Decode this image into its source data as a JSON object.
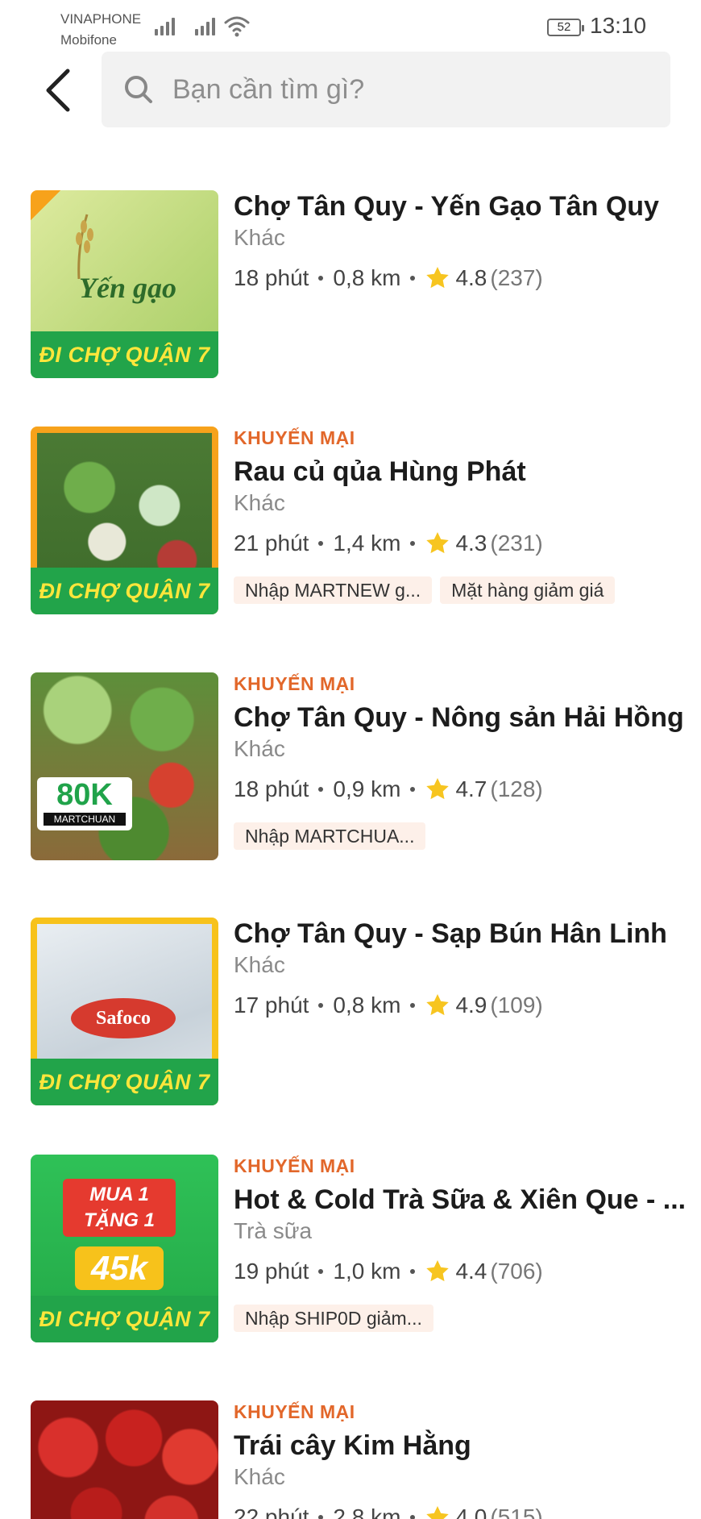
{
  "status_bar": {
    "carrier_1": "VINAPHONE",
    "carrier_2": "Mobifone",
    "battery": "52",
    "time": "13:10"
  },
  "search": {
    "placeholder": "Bạn cần tìm gì?"
  },
  "colors": {
    "promo": "#e2672a",
    "tag_bg": "#fdf0e9",
    "star": "#f7c520",
    "banner_green": "#22a44a"
  },
  "stores": [
    {
      "promo": "",
      "name": "Chợ Tân Quy - Yến Gạo Tân Quy",
      "category": "Khác",
      "time": "18 phút",
      "distance": "0,8 km",
      "rating": "4.8",
      "reviews": "(237)",
      "tags": [],
      "thumb_banner": "ĐI CHỢ QUẬN 7",
      "thumb_text": "Yến gạo"
    },
    {
      "promo": "KHUYẾN MẠI",
      "name": "Rau củ qủa Hùng Phát",
      "category": "Khác",
      "time": "21 phút",
      "distance": "1,4 km",
      "rating": "4.3",
      "reviews": "(231)",
      "tags": [
        "Nhập MARTNEW g...",
        "Mặt hàng giảm giá"
      ],
      "thumb_banner": "ĐI CHỢ QUẬN 7"
    },
    {
      "promo": "KHUYẾN MẠI",
      "name": "Chợ Tân Quy - Nông sản Hải Hồng",
      "category": "Khác",
      "time": "18 phút",
      "distance": "0,9 km",
      "rating": "4.7",
      "reviews": "(128)",
      "tags": [
        "Nhập MARTCHUA..."
      ],
      "thumb_badge": "80K",
      "thumb_badge_sub": "MARTCHUAN"
    },
    {
      "promo": "",
      "name": "Chợ Tân Quy - Sạp Bún Hân Linh",
      "category": "Khác",
      "time": "17 phút",
      "distance": "0,8 km",
      "rating": "4.9",
      "reviews": "(109)",
      "tags": [],
      "thumb_banner": "ĐI CHỢ QUẬN 7",
      "thumb_text": "Safoco"
    },
    {
      "promo": "KHUYẾN MẠI",
      "name": "Hot & Cold Trà Sữa & Xiên Que - ...",
      "category": "Trà sữa",
      "time": "19 phút",
      "distance": "1,0 km",
      "rating": "4.4",
      "reviews": "(706)",
      "tags": [
        "Nhập SHIP0D giảm..."
      ],
      "thumb_banner": "ĐI CHỢ QUẬN 7",
      "thumb_text": "MUA 1 TẶNG 1",
      "thumb_price": "45k"
    },
    {
      "promo": "KHUYẾN MẠI",
      "name": "Trái cây Kim Hằng",
      "category": "Khác",
      "time": "22 phút",
      "distance": "2,8 km",
      "rating": "4.0",
      "reviews": "(515)",
      "tags": []
    }
  ]
}
